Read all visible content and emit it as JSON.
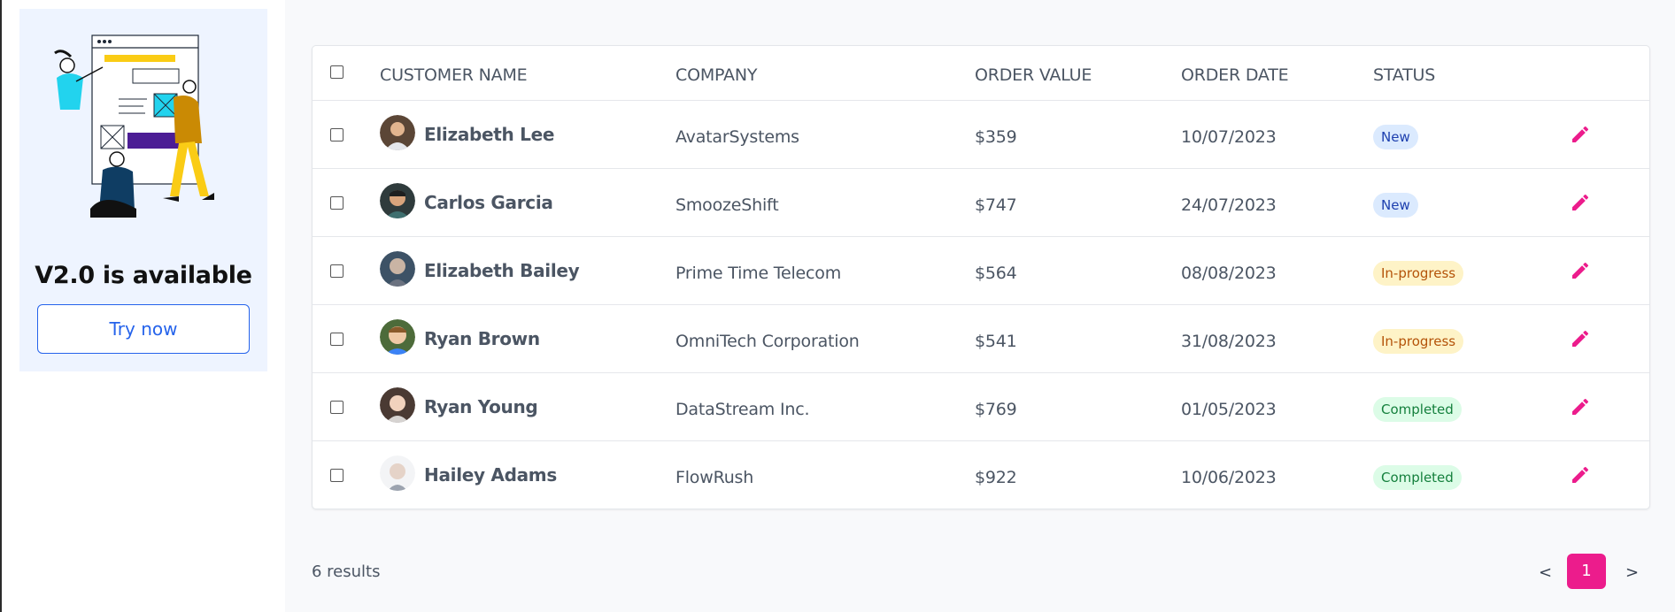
{
  "promo": {
    "title": "V2.0 is available",
    "button_label": "Try now"
  },
  "table": {
    "headers": {
      "customer_name": "CUSTOMER NAME",
      "company": "COMPANY",
      "order_value": "ORDER VALUE",
      "order_date": "ORDER DATE",
      "status": "STATUS"
    },
    "rows": [
      {
        "name": "Elizabeth Lee",
        "company": "AvatarSystems",
        "value": "$359",
        "date": "10/07/2023",
        "status": "New"
      },
      {
        "name": "Carlos Garcia",
        "company": "SmoozeShift",
        "value": "$747",
        "date": "24/07/2023",
        "status": "New"
      },
      {
        "name": "Elizabeth Bailey",
        "company": "Prime Time Telecom",
        "value": "$564",
        "date": "08/08/2023",
        "status": "In-progress"
      },
      {
        "name": "Ryan Brown",
        "company": "OmniTech Corporation",
        "value": "$541",
        "date": "31/08/2023",
        "status": "In-progress"
      },
      {
        "name": "Ryan Young",
        "company": "DataStream Inc.",
        "value": "$769",
        "date": "01/05/2023",
        "status": "Completed"
      },
      {
        "name": "Hailey Adams",
        "company": "FlowRush",
        "value": "$922",
        "date": "10/06/2023",
        "status": "Completed"
      }
    ]
  },
  "footer": {
    "results_text": "6 results",
    "prev": "<",
    "page": "1",
    "next": ">"
  },
  "colors": {
    "accent": "#ec1c8c",
    "link_blue": "#2563eb",
    "status_new_bg": "#dbeafe",
    "status_progress_bg": "#fef3c7",
    "status_completed_bg": "#dcfce7"
  },
  "icons": {
    "edit": "pencil-icon",
    "checkbox": "checkbox-icon"
  }
}
